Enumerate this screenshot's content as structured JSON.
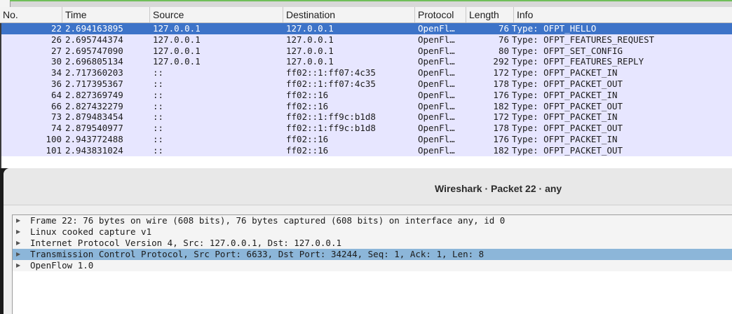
{
  "packet_list": {
    "columns": [
      "No.",
      "Time",
      "Source",
      "Destination",
      "Protocol",
      "Length",
      "Info"
    ],
    "rows": [
      {
        "no": "22",
        "time": "2.694163895",
        "src": "127.0.0.1",
        "dst": "127.0.0.1",
        "proto": "OpenFl…",
        "len": "76",
        "info": "Type: OFPT_HELLO",
        "selected": true
      },
      {
        "no": "26",
        "time": "2.695744374",
        "src": "127.0.0.1",
        "dst": "127.0.0.1",
        "proto": "OpenFl…",
        "len": "76",
        "info": "Type: OFPT_FEATURES_REQUEST"
      },
      {
        "no": "27",
        "time": "2.695747090",
        "src": "127.0.0.1",
        "dst": "127.0.0.1",
        "proto": "OpenFl…",
        "len": "80",
        "info": "Type: OFPT_SET_CONFIG"
      },
      {
        "no": "30",
        "time": "2.696805134",
        "src": "127.0.0.1",
        "dst": "127.0.0.1",
        "proto": "OpenFl…",
        "len": "292",
        "info": "Type: OFPT_FEATURES_REPLY"
      },
      {
        "no": "34",
        "time": "2.717360203",
        "src": "::",
        "dst": "ff02::1:ff07:4c35",
        "proto": "OpenFl…",
        "len": "172",
        "info": "Type: OFPT_PACKET_IN"
      },
      {
        "no": "36",
        "time": "2.717395367",
        "src": "::",
        "dst": "ff02::1:ff07:4c35",
        "proto": "OpenFl…",
        "len": "178",
        "info": "Type: OFPT_PACKET_OUT"
      },
      {
        "no": "64",
        "time": "2.827369749",
        "src": "::",
        "dst": "ff02::16",
        "proto": "OpenFl…",
        "len": "176",
        "info": "Type: OFPT_PACKET_IN"
      },
      {
        "no": "66",
        "time": "2.827432279",
        "src": "::",
        "dst": "ff02::16",
        "proto": "OpenFl…",
        "len": "182",
        "info": "Type: OFPT_PACKET_OUT"
      },
      {
        "no": "73",
        "time": "2.879483454",
        "src": "::",
        "dst": "ff02::1:ff9c:b1d8",
        "proto": "OpenFl…",
        "len": "172",
        "info": "Type: OFPT_PACKET_IN"
      },
      {
        "no": "74",
        "time": "2.879540977",
        "src": "::",
        "dst": "ff02::1:ff9c:b1d8",
        "proto": "OpenFl…",
        "len": "178",
        "info": "Type: OFPT_PACKET_OUT"
      },
      {
        "no": "100",
        "time": "2.943772488",
        "src": "::",
        "dst": "ff02::16",
        "proto": "OpenFl…",
        "len": "176",
        "info": "Type: OFPT_PACKET_IN"
      },
      {
        "no": "101",
        "time": "2.943831024",
        "src": "::",
        "dst": "ff02::16",
        "proto": "OpenFl…",
        "len": "182",
        "info": "Type: OFPT_PACKET_OUT"
      }
    ]
  },
  "dialog": {
    "title": "Wireshark · Packet 22 · any",
    "tree": [
      {
        "label": "Frame 22: 76 bytes on wire (608 bits), 76 bytes captured (608 bits) on interface any, id 0"
      },
      {
        "label": "Linux cooked capture v1"
      },
      {
        "label": "Internet Protocol Version 4, Src: 127.0.0.1, Dst: 127.0.0.1"
      },
      {
        "label": "Transmission Control Protocol, Src Port: 6633, Dst Port: 34244, Seq: 1, Ack: 1, Len: 8",
        "selected": true
      },
      {
        "label": "OpenFlow 1.0"
      }
    ],
    "expander_glyph": "▶"
  },
  "colors": {
    "row_bg": "#e7e6ff",
    "row_selected": "#3d73c8",
    "tree_selected": "#8cb6d9"
  }
}
